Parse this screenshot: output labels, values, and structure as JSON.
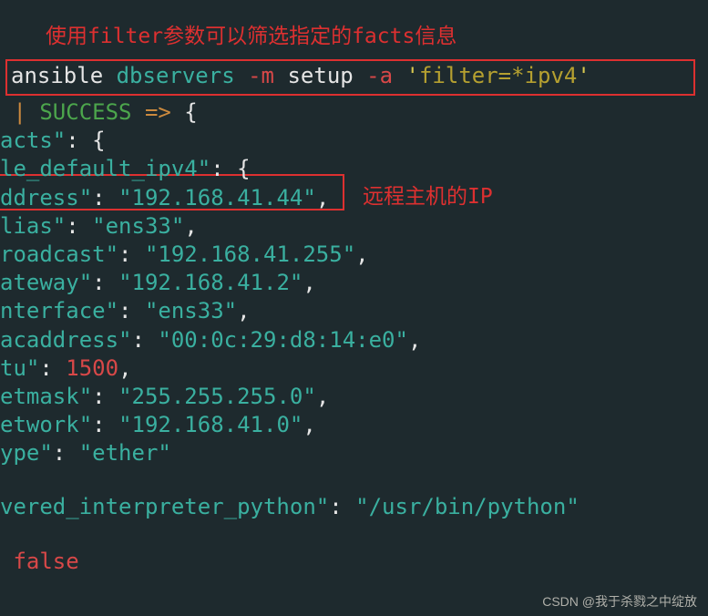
{
  "annotation": {
    "top": "使用filter参数可以筛选指定的facts信息",
    "ip": "远程主机的IP"
  },
  "command": {
    "cmd": "ansible",
    "host": " dbservers ",
    "flag_m": "-m",
    "module": " setup ",
    "flag_a": "-a ",
    "quote1": "'",
    "arg": "filter=*ipv4",
    "quote2": "'"
  },
  "output": {
    "success_pipe": "|",
    "success_text": " SUCCESS ",
    "success_arrow": "=",
    "success_gt": ">",
    "success_brace": " {",
    "l1_pre": "acts\"",
    "l1_colon": ": ",
    "l1_val": "{",
    "l2_pre": "le_default_ipv4\"",
    "l2_colon": ": ",
    "l2_val": "{",
    "l3_pre": "ddress\"",
    "l3_colon": ": ",
    "l3_val": "\"192.168.41.44\"",
    "l3_comma": ",",
    "l4_pre": "lias\"",
    "l4_colon": ": ",
    "l4_val": "\"ens33\"",
    "l4_comma": ",",
    "l5_pre": "roadcast\"",
    "l5_colon": ": ",
    "l5_val": "\"192.168.41.255\"",
    "l5_comma": ",",
    "l6_pre": "ateway\"",
    "l6_colon": ": ",
    "l6_val": "\"192.168.41.2\"",
    "l6_comma": ",",
    "l7_pre": "nterface\"",
    "l7_colon": ": ",
    "l7_val": "\"ens33\"",
    "l7_comma": ",",
    "l8_pre": "acaddress\"",
    "l8_colon": ": ",
    "l8_val": "\"00:0c:29:d8:14:e0\"",
    "l8_comma": ",",
    "l9_pre": "tu\"",
    "l9_colon": ": ",
    "l9_val": "1500",
    "l9_comma": ",",
    "l10_pre": "etmask\"",
    "l10_colon": ": ",
    "l10_val": "\"255.255.255.0\"",
    "l10_comma": ",",
    "l11_pre": "etwork\"",
    "l11_colon": ": ",
    "l11_val": "\"192.168.41.0\"",
    "l11_comma": ",",
    "l12_pre": "ype\"",
    "l12_colon": ": ",
    "l12_val": "\"ether\"",
    "l14_pre": "vered_interpreter_python\"",
    "l14_colon": ": ",
    "l14_val": "\"/usr/bin/python\"",
    "l16_val": " false"
  },
  "watermark": "CSDN @我于杀戮之中绽放"
}
